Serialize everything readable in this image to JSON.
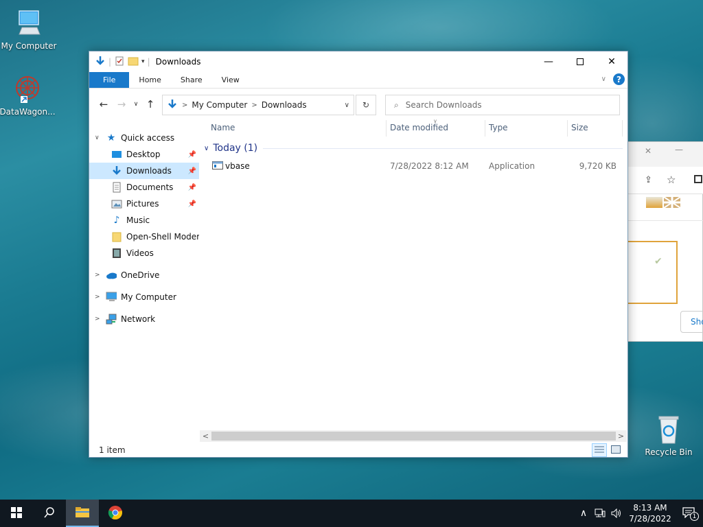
{
  "desktop": {
    "icons": [
      {
        "label": "My Computer"
      },
      {
        "label": "DataWagon..."
      },
      {
        "label": "Recycle Bin"
      }
    ]
  },
  "window": {
    "title": "Downloads",
    "ribbon_tabs": [
      "File",
      "Home",
      "Share",
      "View"
    ],
    "address": {
      "segments": [
        "My Computer",
        "Downloads"
      ]
    },
    "search_placeholder": "Search Downloads",
    "nav": {
      "quick_access": "Quick access",
      "items": [
        "Desktop",
        "Downloads",
        "Documents",
        "Pictures",
        "Music",
        "Open-Shell Modern",
        "Videos"
      ],
      "onedrive": "OneDrive",
      "my_computer": "My Computer",
      "network": "Network"
    },
    "columns": {
      "name": "Name",
      "date": "Date modified",
      "type": "Type",
      "size": "Size"
    },
    "group": "Today (1)",
    "files": [
      {
        "name": "vbase",
        "date": "7/28/2022 8:12 AM",
        "type": "Application",
        "size": "9,720 KB"
      }
    ],
    "status": "1 item"
  },
  "taskbar": {
    "time": "8:13 AM",
    "date": "7/28/2022",
    "notification_count": "1"
  },
  "colors": {
    "accent": "#1979ca",
    "selection": "#cce8ff",
    "group_text": "#1e3287",
    "taskbar": "#101820"
  }
}
